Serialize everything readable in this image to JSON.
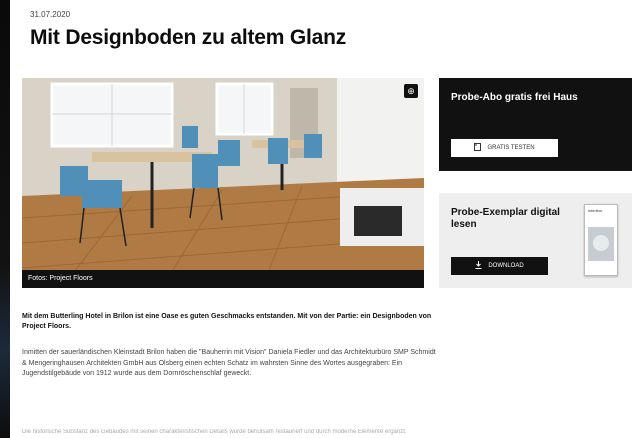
{
  "article": {
    "date": "31.07.2020",
    "title": "Mit Designboden zu altem Glanz",
    "image_caption": "Fotos: Project Floors",
    "intro": "Mit dem Butterling Hotel in Brilon ist eine Oase es guten Geschmacks entstanden. Mit von der Partie: ein Designboden von Project Floors.",
    "body": "Inmitten der sauerländischen Kleinstadt Brilon haben die \"Bauherrin mit Vision\" Daniela Fiedler und das Architekturbüro SMP Schmidt & Mengeringhausen Architekten GmbH aus Olsberg einen echten Schatz im wahrsten Sinne des Wortes ausgegraben: Ein Jugendstilgebäude von 1912 wurde aus dem Dornröschenschlaf geweckt.",
    "faded_line": "Die historische Substanz des Gebäudes mit seinen charakteristischen Details wurde behutsam restauriert und durch moderne Elemente ergänzt."
  },
  "sidebar": {
    "abo": {
      "title": "Probe-Abo gratis frei Haus",
      "button_label": "GRATIS TESTEN",
      "icon": "document-icon"
    },
    "digital": {
      "title": "Probe-Exemplar digital lesen",
      "button_label": "DOWNLOAD",
      "icon": "download-icon",
      "magazine_title": "interieur"
    }
  },
  "icons": {
    "zoom": "zoom-icon"
  },
  "colors": {
    "dark_box": "#111111",
    "light_box": "#eeeeee",
    "text": "#111111",
    "muted": "#444444"
  }
}
